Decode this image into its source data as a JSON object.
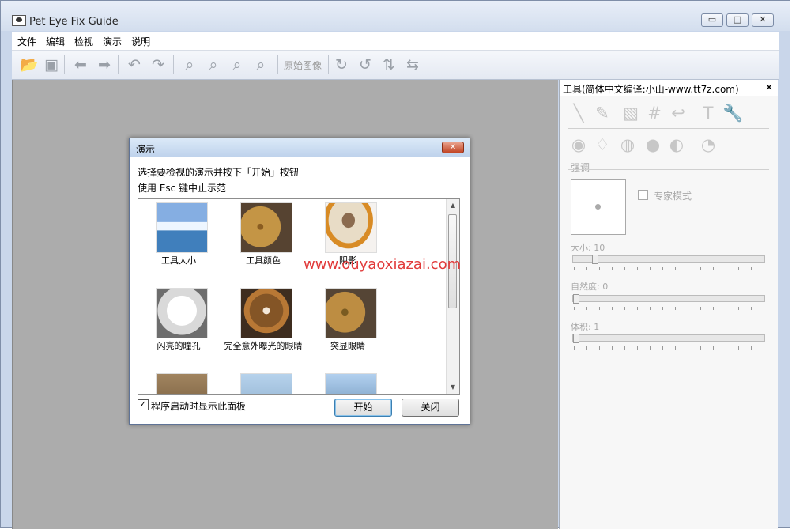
{
  "window": {
    "title": "Pet Eye Fix Guide",
    "controls": [
      "▭",
      "□",
      "✕"
    ]
  },
  "menu": [
    "文件",
    "编辑",
    "检视",
    "演示",
    "说明"
  ],
  "toolbar": {
    "original_image_label": "原始图像",
    "icons": [
      "open-folder-icon",
      "save-icon",
      "back-arrow-icon",
      "forward-arrow-icon",
      "undo-icon",
      "redo-icon",
      "zoom-in-icon",
      "zoom-out-icon",
      "zoom-fit-icon",
      "zoom-actual-icon",
      "rotate-cw-icon",
      "rotate-ccw-icon",
      "flip-vertical-icon",
      "flip-horizontal-icon"
    ]
  },
  "tool_panel": {
    "title": "工具(简体中文编译:小山-www.tt7z.com)",
    "close": "×",
    "section_emphasis": "强调",
    "expert_mode": "专家模式",
    "size_label": "大小: 10",
    "naturalness_label": "自然度: 0",
    "volume_label": "体积: 1",
    "sliders": {
      "size": 0.1,
      "naturalness": 0,
      "volume": 0
    }
  },
  "dialog": {
    "title": "演示",
    "close_symbol": "✕",
    "instruction_line_1": "选择要检视的演示并按下「开始」按钮",
    "instruction_line_2": "使用 Esc 键中止示范",
    "items": [
      {
        "label": "工具大小"
      },
      {
        "label": "工具颜色"
      },
      {
        "label": "阴影"
      },
      {
        "label": "闪亮的瞳孔"
      },
      {
        "label": "完全意外曝光的眼睛"
      },
      {
        "label": "突显眼睛"
      }
    ],
    "show_on_startup_label": "程序启动时显示此面板",
    "show_on_startup_checked": true,
    "start_button": "开始",
    "close_button": "关闭"
  },
  "watermark": "www.ouyaoxiazai.com"
}
